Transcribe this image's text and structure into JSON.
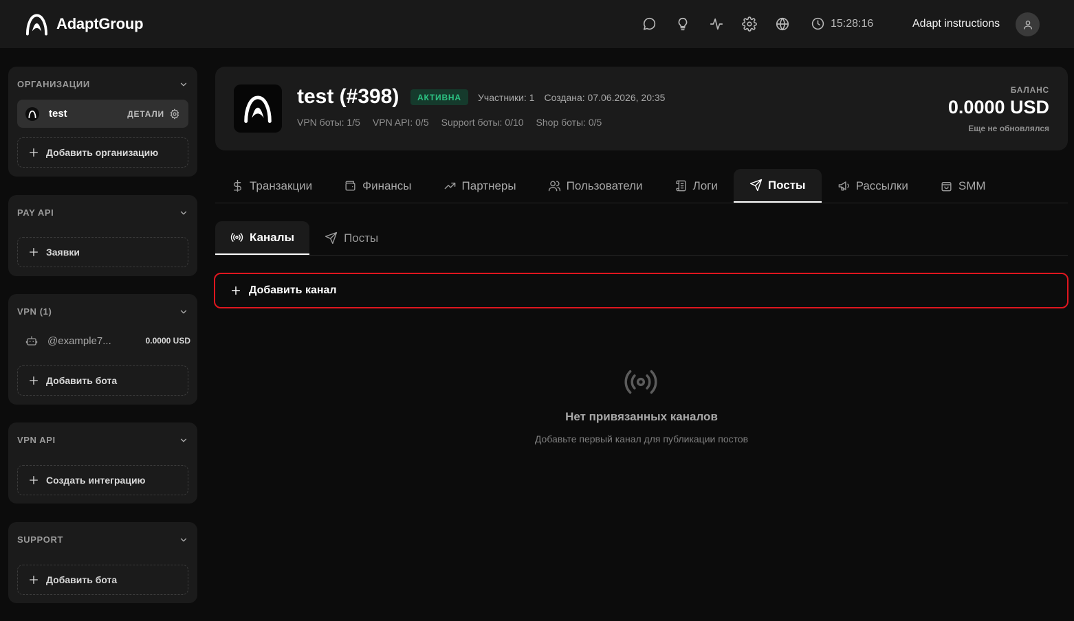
{
  "app": {
    "name": "AdaptGroup"
  },
  "topbar": {
    "icons": [
      "chat-icon",
      "lightbulb-icon",
      "activity-icon",
      "settings-icon",
      "globe-icon"
    ],
    "time": "15:28:16",
    "user_name": "Adapt instructions"
  },
  "sidebar": {
    "organizations": {
      "title": "ОРГАНИЗАЦИИ",
      "current": {
        "name": "test",
        "details_label": "ДЕТАЛИ"
      },
      "add_label": "Добавить организацию"
    },
    "pay_api": {
      "title": "PAY API",
      "add_label": "Заявки"
    },
    "vpn": {
      "title": "VPN (1)",
      "bots": [
        {
          "name": "@example7...",
          "balance": "0.0000 USD"
        }
      ],
      "add_label": "Добавить бота"
    },
    "vpn_api": {
      "title": "VPN API",
      "add_label": "Создать интеграцию"
    },
    "support": {
      "title": "SUPPORT",
      "add_label": "Добавить бота"
    }
  },
  "org": {
    "title": "test (#398)",
    "status": "АКТИВНА",
    "members": "Участники: 1",
    "created": "Создана: 07.06.2026, 20:35",
    "vpn_bots": "VPN боты: 1/5",
    "vpn_api": "VPN API: 0/5",
    "support_bots": "Support боты: 0/10",
    "shop_bots": "Shop боты: 0/5",
    "balance_label": "БАЛАНС",
    "balance_value": "0.0000 USD",
    "balance_note": "Еще не обновлялся"
  },
  "tabs": [
    {
      "label": "Транзакции",
      "icon": "dollar-icon"
    },
    {
      "label": "Финансы",
      "icon": "wallet-icon"
    },
    {
      "label": "Партнеры",
      "icon": "trending-up-icon"
    },
    {
      "label": "Пользователи",
      "icon": "users-icon"
    },
    {
      "label": "Логи",
      "icon": "scroll-icon"
    },
    {
      "label": "Посты",
      "icon": "send-icon",
      "active": true
    },
    {
      "label": "Рассылки",
      "icon": "megaphone-icon"
    },
    {
      "label": "SMM",
      "icon": "shopping-bag-icon"
    }
  ],
  "subtabs": [
    {
      "label": "Каналы",
      "icon": "broadcast-icon",
      "active": true
    },
    {
      "label": "Посты",
      "icon": "send-icon"
    }
  ],
  "channels": {
    "add_label": "Добавить канал",
    "empty_title": "Нет привязанных каналов",
    "empty_subtitle": "Добавьте первый канал для публикации постов"
  },
  "colors": {
    "background": "#0c0c0c",
    "panel": "#1b1b1b",
    "topbar": "#191919",
    "status_active": "#2cc383",
    "highlight": "#e0161f"
  }
}
